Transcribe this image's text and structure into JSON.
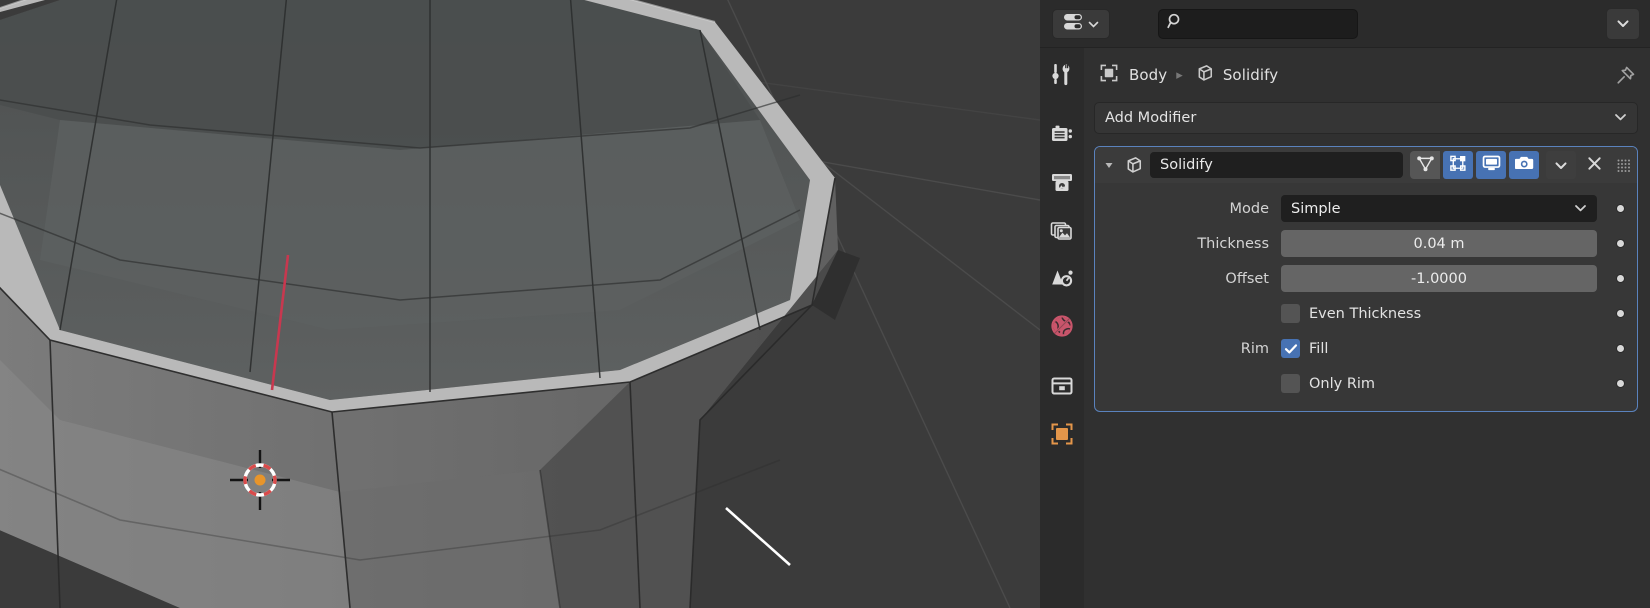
{
  "app": {
    "name": "Blender",
    "editor": "Properties"
  },
  "viewport": {
    "name": "3D Viewport",
    "background_color": "#3b3b3b",
    "mesh_name": "Body",
    "cursor": {
      "name": "3d-cursor",
      "color_ring": "#d94b4b",
      "color_center": "#e8952b"
    },
    "grid_color": "#4a4a4a",
    "selected_edge_color": "#ffffff",
    "seam_edge_color": "#c8384f"
  },
  "properties_header": {
    "editor_type_label": "Editor Type",
    "editor_type_icon": "properties-editor-icon",
    "search": {
      "icon": "search-icon",
      "value": "",
      "placeholder": ""
    },
    "options_dropdown_icon": "chevron-down-icon"
  },
  "tabs": [
    {
      "id": "tool",
      "label": "Tool",
      "icon": "tool-icon",
      "active": false
    },
    {
      "id": "render",
      "label": "Render",
      "icon": "camera-back-icon",
      "active": false
    },
    {
      "id": "output",
      "label": "Output",
      "icon": "printer-icon",
      "active": false
    },
    {
      "id": "view-layer",
      "label": "View Layer",
      "icon": "images-icon",
      "active": false
    },
    {
      "id": "scene",
      "label": "Scene",
      "icon": "scene-icon",
      "active": false
    },
    {
      "id": "world",
      "label": "World",
      "icon": "world-globe-icon",
      "active": false
    },
    {
      "id": "collection",
      "label": "Collection",
      "icon": "box-icon",
      "active": false
    },
    {
      "id": "object",
      "label": "Object",
      "icon": "object-icon",
      "active": false
    }
  ],
  "breadcrumb": {
    "object_icon": "object-icon",
    "object_name": "Body",
    "separator": "▸",
    "modifier_icon": "modifier-cube-icon",
    "modifier_name": "Solidify",
    "pin_icon": "pin-icon",
    "pin_label": "Pin ID"
  },
  "add_modifier": {
    "label": "Add Modifier",
    "chevron_icon": "chevron-down-icon"
  },
  "modifier": {
    "expand_icon": "triangle-down-icon",
    "type_icon": "modifier-cube-icon",
    "name": "Solidify",
    "toggles": [
      {
        "id": "on-cage",
        "label": "On Cage",
        "icon": "vertex-triangle-icon",
        "on": false
      },
      {
        "id": "edit-mode",
        "label": "Edit Mode",
        "icon": "editmode-icon",
        "on": true
      },
      {
        "id": "realtime",
        "label": "Realtime",
        "icon": "monitor-icon",
        "on": true
      },
      {
        "id": "render",
        "label": "Render",
        "icon": "camera-icon",
        "on": true
      }
    ],
    "extras_icon": "chevron-down-icon",
    "extras_label": "Extras",
    "close_icon": "close-x-icon",
    "close_label": "Delete modifier",
    "drag_icon": "drag-grip-icon",
    "rows": [
      {
        "kind": "enum",
        "label": "Mode",
        "value": "Simple",
        "animate_dot": true
      },
      {
        "kind": "slider",
        "label": "Thickness",
        "value": "0.04 m",
        "animate_dot": true
      },
      {
        "kind": "slider",
        "label": "Offset",
        "value": "-1.0000",
        "animate_dot": true
      },
      {
        "kind": "checkbox",
        "label": "",
        "value": "Even Thickness",
        "checked": false,
        "animate_dot": true
      },
      {
        "kind": "checkbox",
        "label": "Rim",
        "value": "Fill",
        "checked": true,
        "animate_dot": true
      },
      {
        "kind": "checkbox",
        "label": "",
        "value": "Only Rim",
        "checked": false,
        "animate_dot": true
      }
    ]
  },
  "colors": {
    "accent_blue": "#4772b3",
    "panel_outline": "#5a82bd",
    "editor_bg": "#303030",
    "header_bg": "#2b2b2b",
    "field_dark": "#1f1f1f",
    "field_slider": "#656565",
    "world_icon_red": "#d2566b",
    "object_icon_orange": "#e4964a"
  }
}
